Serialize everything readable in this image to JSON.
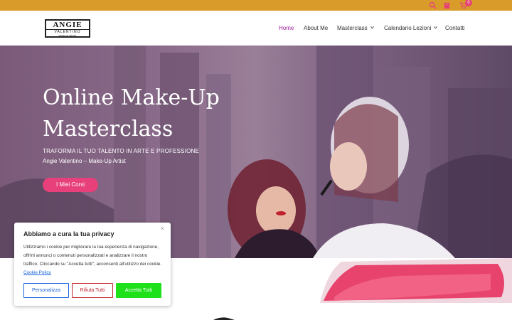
{
  "topbar": {
    "cart_count": "0",
    "icons": [
      "search-icon",
      "shopping-bag-icon",
      "cart-icon"
    ]
  },
  "header": {
    "logo": {
      "line1": "ANGIE",
      "line2": "VALENTINO",
      "line3": "MAKE-UP ARTIST"
    },
    "nav": [
      {
        "label": "Home",
        "active": true
      },
      {
        "label": "About Me"
      },
      {
        "label": "Masterclass",
        "dropdown": true
      },
      {
        "label": "Calendario Lezioni",
        "dropdown": true
      },
      {
        "label": "Contatti"
      }
    ]
  },
  "hero": {
    "title": "Online Make-Up Masterclass",
    "subtitle": "TRAFORMA IL TUO TALENTO IN ARTE E PROFESSIONE",
    "tagline": "Angie Valentino – Make-Up Artist",
    "button": "I Miei Corsi"
  },
  "cookie": {
    "title": "Abbiamo a cura la tua privacy",
    "close": "×",
    "text": "Utilizziamo i cookie per migliorare la tua esperienza di navigazione, offrirti annunci o contenuti personalizzati e analizzare il nostro traffico. Cliccando su \"Accetta tutti\", acconsenti all'utilizzo dei cookie.",
    "policy_link": "Cookie Policy",
    "buttons": {
      "customize": "Personalizza",
      "reject": "Rifiuta Tutti",
      "accept": "Accetta Tutti"
    }
  },
  "colors": {
    "topbar": "#d99b2a",
    "accent": "#e8407a",
    "nav_active": "#9c1e9e",
    "cookie_link": "#1863dc",
    "reject": "#c0262c",
    "accept": "#1ee11a"
  }
}
